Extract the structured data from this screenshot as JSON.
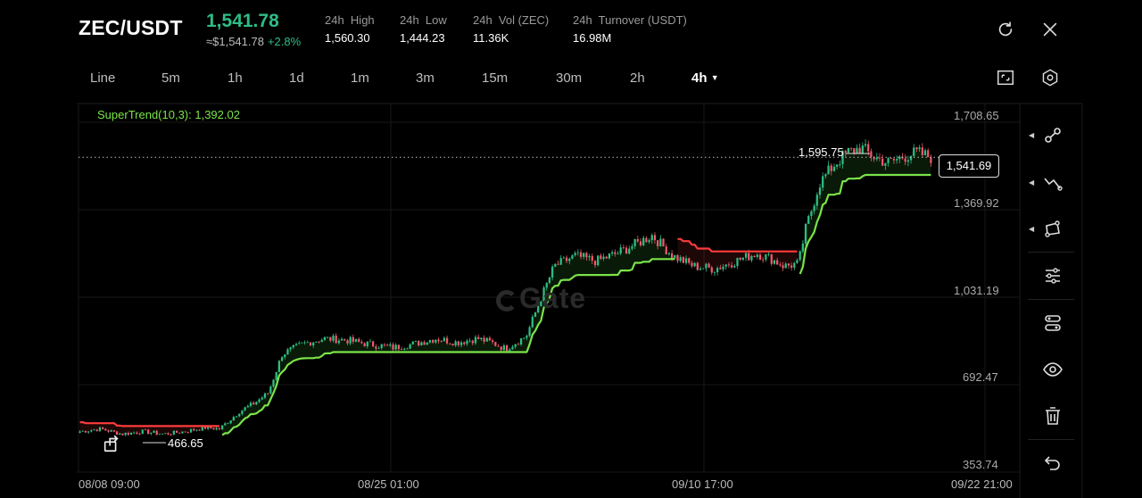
{
  "header": {
    "pair": "ZEC/USDT",
    "last_price": "1,541.78",
    "approx_price": "≈$1,541.78",
    "change": "+2.8%",
    "stats": [
      {
        "label": "24h  High",
        "value": "1,560.30"
      },
      {
        "label": "24h  Low",
        "value": "1,444.23"
      },
      {
        "label": "24h  Vol (ZEC)",
        "value": "11.36K"
      },
      {
        "label": "24h  Turnover (USDT)",
        "value": "16.98M"
      }
    ],
    "icons": [
      "refresh-icon",
      "close-icon"
    ]
  },
  "timeframes": {
    "items": [
      "Line",
      "5m",
      "1h",
      "1d",
      "1m",
      "3m",
      "15m",
      "30m",
      "2h",
      "4h"
    ],
    "active": "4h",
    "icons": [
      "fullscreen-icon",
      "settings-icon"
    ]
  },
  "indicator": {
    "label": "SuperTrend(10,3): 1,392.02"
  },
  "watermark": "Gate",
  "sidebar": {
    "icons": [
      "trend-line-tool-icon",
      "multi-line-tool-icon",
      "shape-tool-icon",
      "indicator-settings-icon",
      "layers-icon",
      "visibility-eye-icon",
      "trash-icon",
      "undo-icon"
    ]
  },
  "colors": {
    "up": "#2fbd85",
    "down": "#f05a6a",
    "supertrend_up": "#7be34a",
    "supertrend_down": "#ff3b3b",
    "indicator_label": "#7be34a"
  },
  "chart_data": {
    "type": "candlestick",
    "symbol": "ZEC/USDT",
    "interval": "4h",
    "y_ticks": [
      "1,708.65",
      "1,369.92",
      "1,031.19",
      "692.47",
      "353.74"
    ],
    "y_tick_values": [
      1708.65,
      1369.92,
      1031.19,
      692.47,
      353.74
    ],
    "x_ticks": [
      "08/08 09:00",
      "08/25 01:00",
      "09/10 17:00",
      "09/22 21:00"
    ],
    "current_price_label": "1,541.69",
    "current_price": 1541.69,
    "high_marker": {
      "label": "1,595.75",
      "value": 1595.75
    },
    "low_marker": {
      "label": "466.65",
      "value": 466.65
    },
    "supertrend_value": 1392.02,
    "grid": true,
    "approx_path": [
      [
        0,
        480
      ],
      [
        6,
        490
      ],
      [
        12,
        470
      ],
      [
        18,
        480
      ],
      [
        24,
        470
      ],
      [
        30,
        480
      ],
      [
        36,
        495
      ],
      [
        40,
        490
      ],
      [
        46,
        560
      ],
      [
        50,
        590
      ],
      [
        54,
        630
      ],
      [
        58,
        780
      ],
      [
        64,
        820
      ],
      [
        70,
        840
      ],
      [
        76,
        835
      ],
      [
        82,
        820
      ],
      [
        90,
        805
      ],
      [
        96,
        820
      ],
      [
        102,
        840
      ],
      [
        108,
        825
      ],
      [
        114,
        840
      ],
      [
        118,
        825
      ],
      [
        122,
        800
      ],
      [
        128,
        850
      ],
      [
        132,
        990
      ],
      [
        136,
        1120
      ],
      [
        142,
        1160
      ],
      [
        148,
        1140
      ],
      [
        154,
        1170
      ],
      [
        160,
        1210
      ],
      [
        164,
        1240
      ],
      [
        170,
        1160
      ],
      [
        176,
        1120
      ],
      [
        182,
        1110
      ],
      [
        188,
        1140
      ],
      [
        194,
        1170
      ],
      [
        198,
        1150
      ],
      [
        202,
        1120
      ],
      [
        206,
        1130
      ],
      [
        208,
        1260
      ],
      [
        212,
        1440
      ],
      [
        216,
        1510
      ],
      [
        220,
        1560
      ],
      [
        224,
        1580
      ],
      [
        228,
        1540
      ],
      [
        232,
        1520
      ],
      [
        236,
        1545
      ],
      [
        240,
        1560
      ],
      [
        244,
        1542
      ]
    ]
  }
}
